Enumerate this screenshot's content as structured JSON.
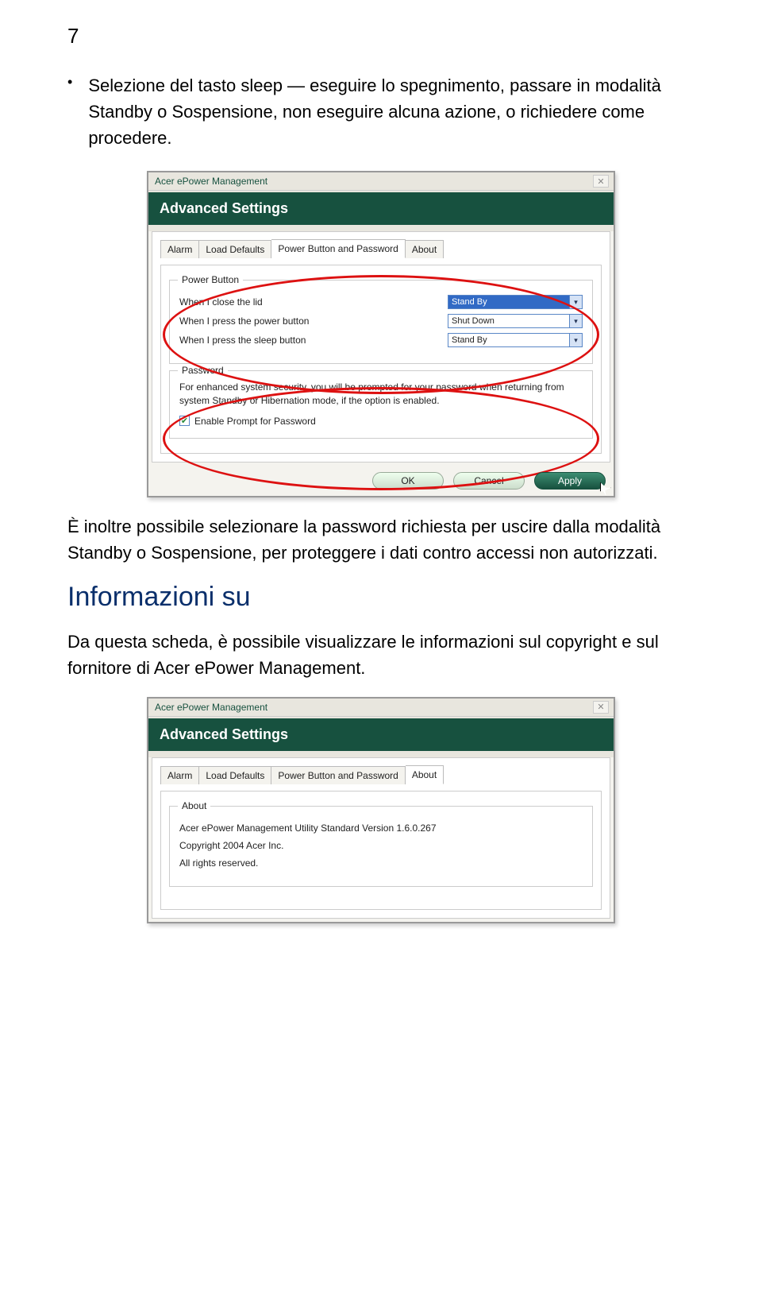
{
  "page_number": "7",
  "bullet": "Selezione del tasto sleep — eseguire lo spegnimento, passare in modalità Standby o Sospensione, non eseguire alcuna azione, o richiedere come procedere.",
  "dialog1": {
    "titlebar": "Acer ePower Management",
    "header": "Advanced Settings",
    "tabs": {
      "alarm": "Alarm",
      "load_defaults": "Load Defaults",
      "power_button": "Power Button and Password",
      "about": "About"
    },
    "power_group": {
      "title": "Power Button",
      "rows": {
        "lid": {
          "label": "When I close the lid",
          "value": "Stand By"
        },
        "power": {
          "label": "When I press the power button",
          "value": "Shut Down"
        },
        "sleep": {
          "label": "When I press the sleep button",
          "value": "Stand By"
        }
      }
    },
    "password_group": {
      "title": "Password",
      "desc": "For enhanced system security, you will be prompted for your password when returning from system Standby or Hibernation mode, if the option is enabled.",
      "checkbox": "Enable Prompt for Password"
    },
    "buttons": {
      "ok": "OK",
      "cancel": "Cancel",
      "apply": "Apply"
    }
  },
  "paragraph": "È inoltre possibile selezionare la password richiesta per uscire dalla modalità Standby o Sospensione, per proteggere i dati contro accessi non autorizzati.",
  "heading": "Informazioni su",
  "paragraph2": "Da questa scheda, è possibile visualizzare le informazioni sul copyright e sul fornitore di Acer ePower Management.",
  "dialog2": {
    "titlebar": "Acer ePower Management",
    "header": "Advanced Settings",
    "tabs": {
      "alarm": "Alarm",
      "load_defaults": "Load Defaults",
      "power_button": "Power Button and Password",
      "about": "About"
    },
    "about_group": {
      "title": "About",
      "line1": "Acer ePower Management Utility Standard Version 1.6.0.267",
      "line2": "Copyright 2004 Acer Inc.",
      "line3": "All rights reserved."
    }
  }
}
